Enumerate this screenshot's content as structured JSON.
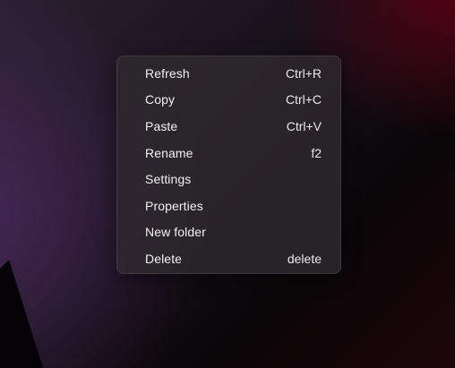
{
  "context_menu": {
    "items": [
      {
        "label": "Refresh",
        "shortcut": "Ctrl+R"
      },
      {
        "label": "Copy",
        "shortcut": "Ctrl+C"
      },
      {
        "label": "Paste",
        "shortcut": "Ctrl+V"
      },
      {
        "label": "Rename",
        "shortcut": "f2"
      },
      {
        "label": "Settings",
        "shortcut": ""
      },
      {
        "label": "Properties",
        "shortcut": ""
      },
      {
        "label": "New folder",
        "shortcut": ""
      },
      {
        "label": "Delete",
        "shortcut": "delete"
      }
    ]
  },
  "colors": {
    "menu_background": "#302a30",
    "menu_text": "#f2f2f2",
    "wallpaper_purple": "#503264",
    "wallpaper_red": "#5a0014"
  }
}
